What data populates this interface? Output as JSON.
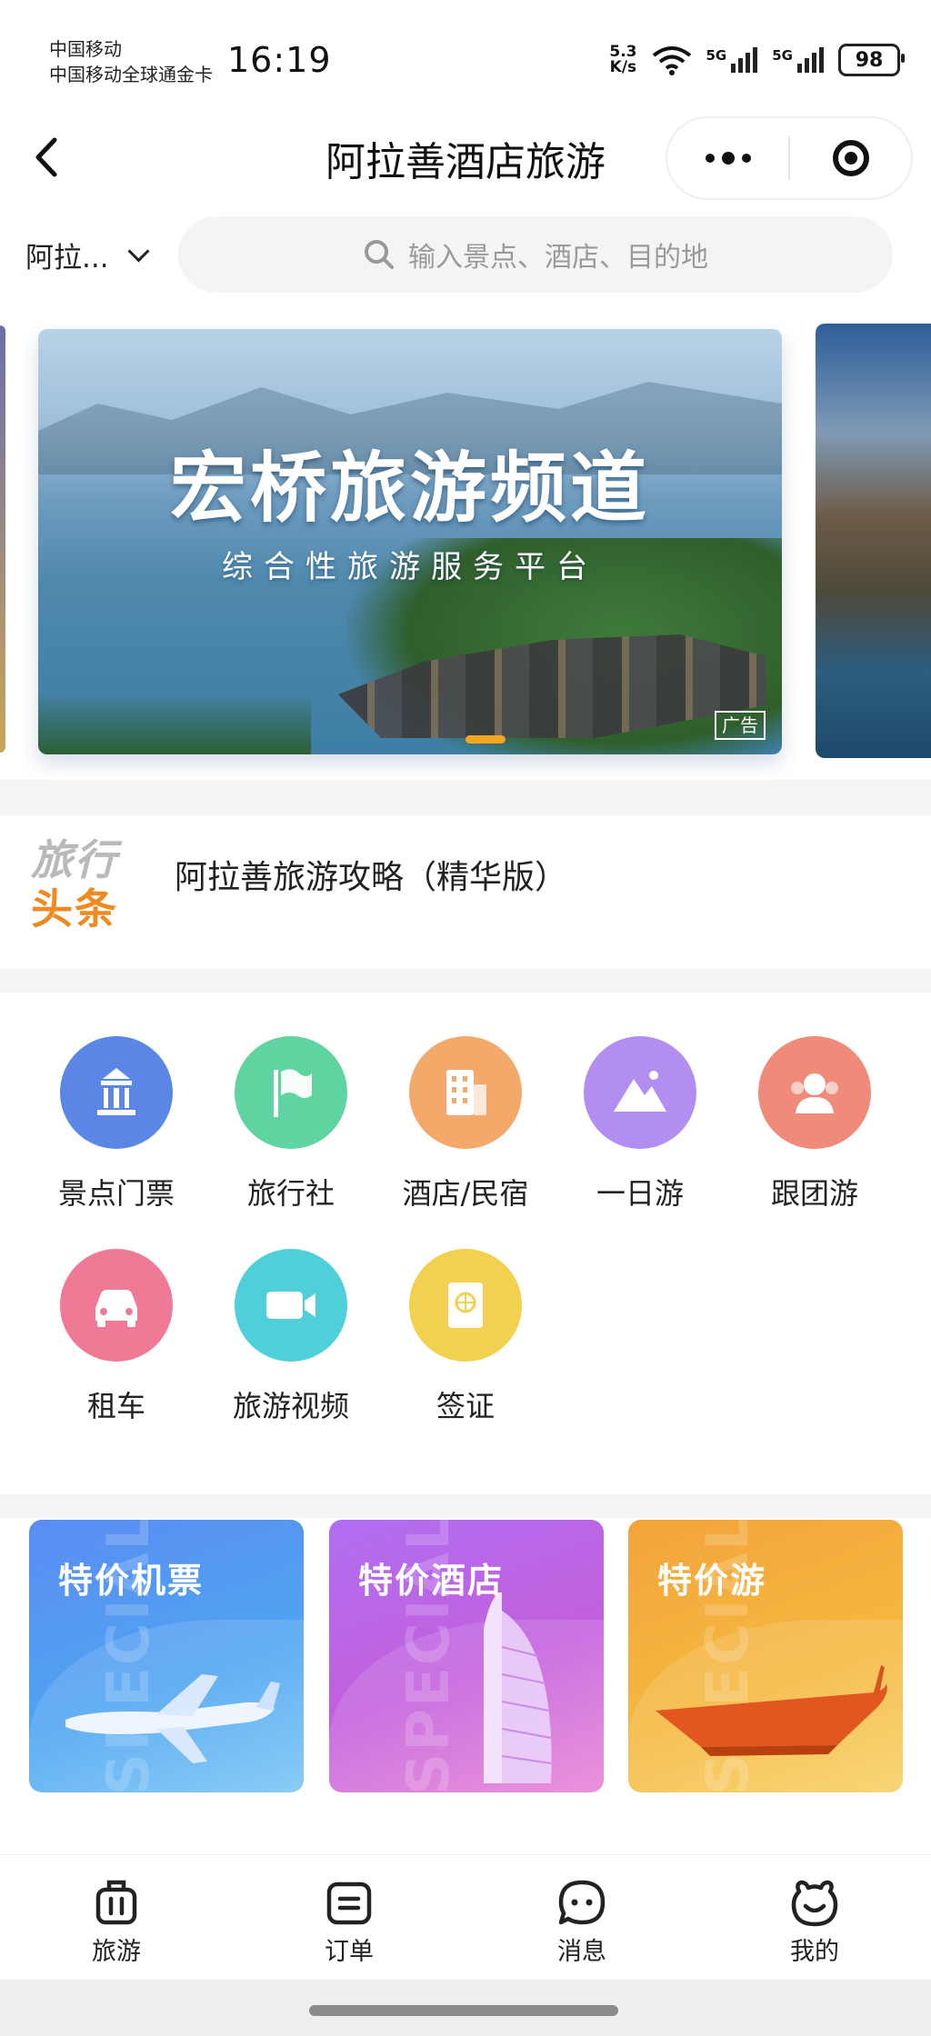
{
  "status_bar": {
    "carrier_1": "中国移动",
    "carrier_2": "中国移动全球通金卡",
    "time": "16:19",
    "net_speed_value": "5.3",
    "net_speed_unit": "K/s",
    "sim1_label": "5G",
    "sim2_label": "5G",
    "battery": "98"
  },
  "header": {
    "title": "阿拉善酒店旅游"
  },
  "search": {
    "city": "阿拉...",
    "placeholder": "输入景点、酒店、目的地"
  },
  "banner": {
    "title": "宏桥旅游频道",
    "subtitle": "综合性旅游服务平台",
    "ad_label": "广告"
  },
  "headline": {
    "logo_top": "旅行",
    "logo_bottom": "头条",
    "text": "阿拉善旅游攻略（精华版）"
  },
  "categories": [
    {
      "label": "景点门票",
      "color": "#5b86e5",
      "icon": "temple-icon"
    },
    {
      "label": "旅行社",
      "color": "#5fd3a0",
      "icon": "flag-icon"
    },
    {
      "label": "酒店/民宿",
      "color": "#f2a96a",
      "icon": "building-icon"
    },
    {
      "label": "一日游",
      "color": "#b28ef0",
      "icon": "mountain-icon"
    },
    {
      "label": "跟团游",
      "color": "#f08a7a",
      "icon": "group-icon"
    },
    {
      "label": "租车",
      "color": "#f07a95",
      "icon": "car-icon"
    },
    {
      "label": "旅游视频",
      "color": "#4fd0d8",
      "icon": "video-icon"
    },
    {
      "label": "签证",
      "color": "#f2d050",
      "icon": "passport-icon"
    }
  ],
  "promos": [
    {
      "title": "特价机票",
      "special": "SPECIAL",
      "icon": "airplane-icon"
    },
    {
      "title": "特价酒店",
      "special": "SPECIAL",
      "icon": "hotel-tower-icon"
    },
    {
      "title": "特价游",
      "special": "SPECIAL",
      "icon": "boat-icon"
    }
  ],
  "tabbar": [
    {
      "label": "旅游",
      "icon": "luggage-icon"
    },
    {
      "label": "订单",
      "icon": "order-icon"
    },
    {
      "label": "消息",
      "icon": "message-icon"
    },
    {
      "label": "我的",
      "icon": "profile-icon"
    }
  ]
}
